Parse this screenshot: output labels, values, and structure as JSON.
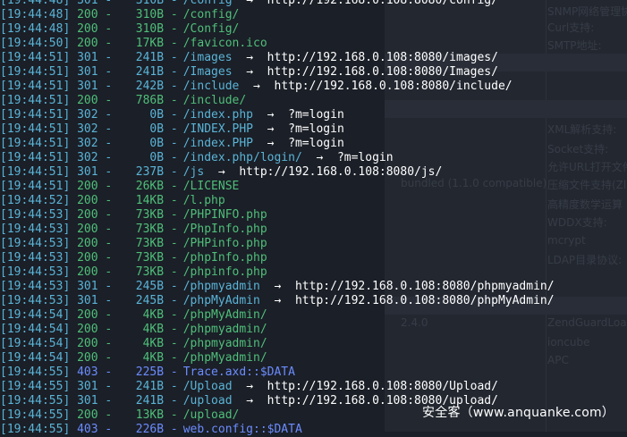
{
  "background_window": {
    "labels": [
      "SNMP网络管理协",
      "Curl支持:",
      "SMTP地址:",
      "XML解析支持:",
      "Socket支持:",
      "允许URL打开文件",
      "压缩文件支持(Zl",
      "bundled (1.1.0 compatible)",
      "高精度数学运算",
      "WDDX支持:",
      "mcrypt",
      "LDAP目录协议:",
      "2.4.0",
      "ZendGuardLoad",
      "ioncube",
      "APC"
    ]
  },
  "terminal": {
    "lines": [
      {
        "time": "[19:44:48]",
        "status": "301",
        "size": "310B",
        "path": "/config",
        "arrow": "→",
        "redirect": "http://192.168.0.108:8080/config/"
      },
      {
        "time": "[19:44:48]",
        "status": "200",
        "size": "310B",
        "path": "/config/",
        "arrow": "",
        "redirect": ""
      },
      {
        "time": "[19:44:48]",
        "status": "200",
        "size": "310B",
        "path": "/Config/",
        "arrow": "",
        "redirect": ""
      },
      {
        "time": "[19:44:50]",
        "status": "200",
        "size": "17KB",
        "path": "/favicon.ico",
        "arrow": "",
        "redirect": ""
      },
      {
        "time": "[19:44:51]",
        "status": "301",
        "size": "241B",
        "path": "/images",
        "arrow": "→",
        "redirect": "http://192.168.0.108:8080/images/"
      },
      {
        "time": "[19:44:51]",
        "status": "301",
        "size": "241B",
        "path": "/Images",
        "arrow": "→",
        "redirect": "http://192.168.0.108:8080/Images/"
      },
      {
        "time": "[19:44:51]",
        "status": "301",
        "size": "242B",
        "path": "/include",
        "arrow": "→",
        "redirect": "http://192.168.0.108:8080/include/"
      },
      {
        "time": "[19:44:51]",
        "status": "200",
        "size": "786B",
        "path": "/include/",
        "arrow": "",
        "redirect": ""
      },
      {
        "time": "[19:44:51]",
        "status": "302",
        "size": "0B",
        "path": "/index.php",
        "arrow": "→",
        "redirect": "?m=login"
      },
      {
        "time": "[19:44:51]",
        "status": "302",
        "size": "0B",
        "path": "/INDEX.PHP",
        "arrow": "→",
        "redirect": "?m=login"
      },
      {
        "time": "[19:44:51]",
        "status": "302",
        "size": "0B",
        "path": "/index.PHP",
        "arrow": "→",
        "redirect": "?m=login"
      },
      {
        "time": "[19:44:51]",
        "status": "302",
        "size": "0B",
        "path": "/index.php/login/",
        "arrow": "→",
        "redirect": "?m=login"
      },
      {
        "time": "[19:44:51]",
        "status": "301",
        "size": "237B",
        "path": "/js",
        "arrow": "→",
        "redirect": "http://192.168.0.108:8080/js/"
      },
      {
        "time": "[19:44:51]",
        "status": "200",
        "size": "26KB",
        "path": "/LICENSE",
        "arrow": "",
        "redirect": ""
      },
      {
        "time": "[19:44:52]",
        "status": "200",
        "size": "14KB",
        "path": "/l.php",
        "arrow": "",
        "redirect": ""
      },
      {
        "time": "[19:44:53]",
        "status": "200",
        "size": "73KB",
        "path": "/PHPINFO.php",
        "arrow": "",
        "redirect": ""
      },
      {
        "time": "[19:44:53]",
        "status": "200",
        "size": "73KB",
        "path": "/PhpInfo.php",
        "arrow": "",
        "redirect": ""
      },
      {
        "time": "[19:44:53]",
        "status": "200",
        "size": "73KB",
        "path": "/PHPinfo.php",
        "arrow": "",
        "redirect": ""
      },
      {
        "time": "[19:44:53]",
        "status": "200",
        "size": "73KB",
        "path": "/phpInfo.php",
        "arrow": "",
        "redirect": ""
      },
      {
        "time": "[19:44:53]",
        "status": "200",
        "size": "73KB",
        "path": "/phpinfo.php",
        "arrow": "",
        "redirect": ""
      },
      {
        "time": "[19:44:53]",
        "status": "301",
        "size": "245B",
        "path": "/phpmyadmin",
        "arrow": "→",
        "redirect": "http://192.168.0.108:8080/phpmyadmin/"
      },
      {
        "time": "[19:44:53]",
        "status": "301",
        "size": "245B",
        "path": "/phpMyAdmin",
        "arrow": "→",
        "redirect": "http://192.168.0.108:8080/phpMyAdmin/"
      },
      {
        "time": "[19:44:54]",
        "status": "200",
        "size": "4KB",
        "path": "/phpMyAdmin/",
        "arrow": "",
        "redirect": ""
      },
      {
        "time": "[19:44:54]",
        "status": "200",
        "size": "4KB",
        "path": "/phpmyadmin/",
        "arrow": "",
        "redirect": ""
      },
      {
        "time": "[19:44:54]",
        "status": "200",
        "size": "4KB",
        "path": "/phpmyadmin/",
        "arrow": "",
        "redirect": ""
      },
      {
        "time": "[19:44:54]",
        "status": "200",
        "size": "4KB",
        "path": "/phpMyadmin/",
        "arrow": "",
        "redirect": ""
      },
      {
        "time": "[19:44:55]",
        "status": "403",
        "size": "225B",
        "path": "Trace.axd::$DATA",
        "arrow": "",
        "redirect": ""
      },
      {
        "time": "[19:44:55]",
        "status": "301",
        "size": "241B",
        "path": "/Upload",
        "arrow": "→",
        "redirect": "http://192.168.0.108:8080/Upload/"
      },
      {
        "time": "[19:44:55]",
        "status": "301",
        "size": "241B",
        "path": "/upload",
        "arrow": "→",
        "redirect": "http://192.168.0.108:8080/upload/"
      },
      {
        "time": "[19:44:55]",
        "status": "200",
        "size": "13KB",
        "path": "/upload/",
        "arrow": "",
        "redirect": ""
      },
      {
        "time": "[19:44:55]",
        "status": "403",
        "size": "226B",
        "path": "web.config::$DATA",
        "arrow": "",
        "redirect": ""
      }
    ]
  },
  "watermark": "安全客（www.anquanke.com）",
  "colors": {
    "background": "#1b1f27",
    "timestamp": "#5ab4d7",
    "status_200": "#4fbf7a",
    "status_30x": "#5ab4d7",
    "status_403": "#6b8cff",
    "redirect": "#ffffff"
  }
}
